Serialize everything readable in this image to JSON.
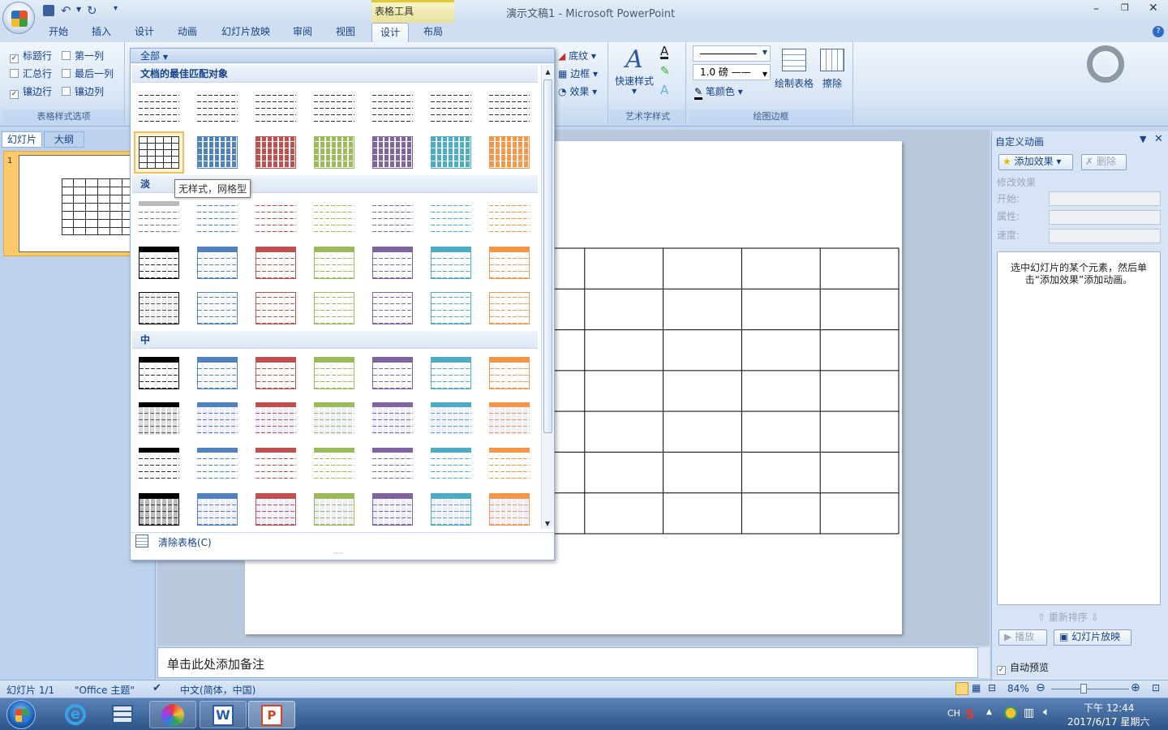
{
  "titlebar": {
    "context_tool": "表格工具",
    "title": "演示文稿1 - Microsoft PowerPoint"
  },
  "tabs": [
    "开始",
    "插入",
    "设计",
    "动画",
    "幻灯片放映",
    "审阅",
    "视图",
    "设计",
    "布局"
  ],
  "table_style_options": {
    "items": [
      {
        "label": "标题行",
        "checked": true
      },
      {
        "label": "第一列",
        "checked": false
      },
      {
        "label": "汇总行",
        "checked": false
      },
      {
        "label": "最后一列",
        "checked": false
      },
      {
        "label": "镶边行",
        "checked": true
      },
      {
        "label": "镶边列",
        "checked": false
      }
    ],
    "group_name": "表格样式选项"
  },
  "shading": {
    "shading": "底纹",
    "border": "边框",
    "effect": "效果"
  },
  "wordart": {
    "quick_styles": "快速样式",
    "group_name": "艺术字样式"
  },
  "draw_borders": {
    "pen_weight": "1.0 磅",
    "pen_color": "笔颜色",
    "draw_table": "绘制表格",
    "eraser": "擦除",
    "group_name": "绘图边框"
  },
  "gallery": {
    "filter": "全部",
    "section_best": "文档的最佳匹配对象",
    "section_light": "淡",
    "section_medium": "中",
    "tooltip": "无样式，网格型",
    "clear": "清除表格(C)"
  },
  "slide_panel": {
    "tab_slides": "幻灯片",
    "tab_outline": "大纲",
    "slide_number": "1"
  },
  "notes": {
    "placeholder": "单击此处添加备注"
  },
  "custom_animation": {
    "title": "自定义动画",
    "add_effect": "添加效果",
    "remove": "删除",
    "modify": "修改效果",
    "start": "开始:",
    "property": "属性:",
    "speed": "速度:",
    "hint": "选中幻灯片的某个元素，然后单击“添加效果”添加动画。",
    "reorder": "重新排序",
    "play": "播放",
    "slideshow": "幻灯片放映",
    "autopreview": "自动预览",
    "autopreview_checked": true
  },
  "status": {
    "slide": "幻灯片 1/1",
    "theme": "\"Office 主题\"",
    "language": "中文(简体，中国)",
    "zoom": "84%"
  },
  "taskbar": {
    "lang": "CH",
    "time": "下午 12:44",
    "date": "2017/6/17 星期六"
  },
  "colors": {
    "accents": [
      "#ffffff",
      "#4f81bd",
      "#c0504d",
      "#9bbb59",
      "#8064a2",
      "#4bacc6",
      "#f79646"
    ]
  }
}
